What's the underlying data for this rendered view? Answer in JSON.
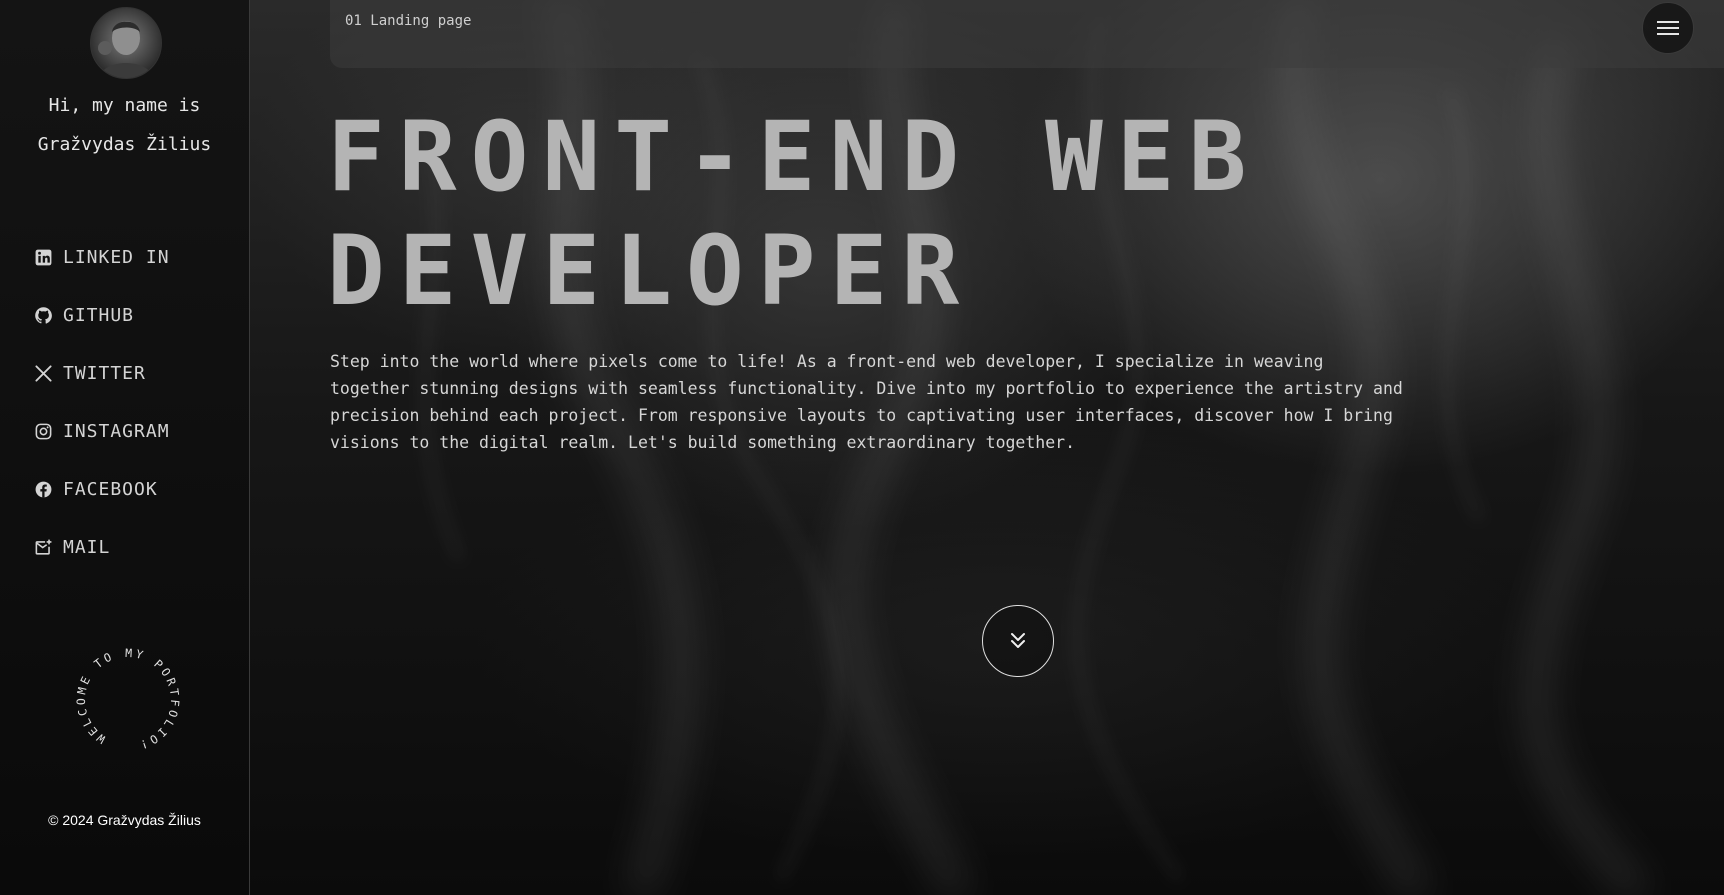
{
  "sidebar": {
    "intro_line1": "Hi, my name is",
    "intro_line2": "Gražvydas Žilius",
    "social_links": [
      {
        "label": "LINKED IN",
        "icon": "linkedin-icon"
      },
      {
        "label": "GITHUB",
        "icon": "github-icon"
      },
      {
        "label": "TWITTER",
        "icon": "x-twitter-icon"
      },
      {
        "label": "INSTAGRAM",
        "icon": "instagram-icon"
      },
      {
        "label": "FACEBOOK",
        "icon": "facebook-icon"
      },
      {
        "label": "MAIL",
        "icon": "mail-icon"
      }
    ],
    "badge_text": "WELCOME TO MY PORTFOLIO!",
    "copyright": "© 2024 Gražvydas Žilius"
  },
  "header": {
    "breadcrumb": "01 Landing page",
    "menu_icon": "hamburger-menu-icon"
  },
  "main": {
    "headline_line1": "FRONT-END WEB",
    "headline_line2": "DEVELOPER",
    "description": "Step into the world where pixels come to life! As a front-end web developer, I specialize in weaving together stunning designs with seamless functionality. Dive into my portfolio to experience the artistry and precision behind each project. From responsive layouts to captivating user interfaces, discover how I bring visions to the digital realm. Let's build something extraordinary together.",
    "scroll_icon": "chevrons-down-icon"
  },
  "colors": {
    "headline": "#b4b4b4",
    "text": "#d6d6d6",
    "sidebar_bg": "#111111"
  }
}
